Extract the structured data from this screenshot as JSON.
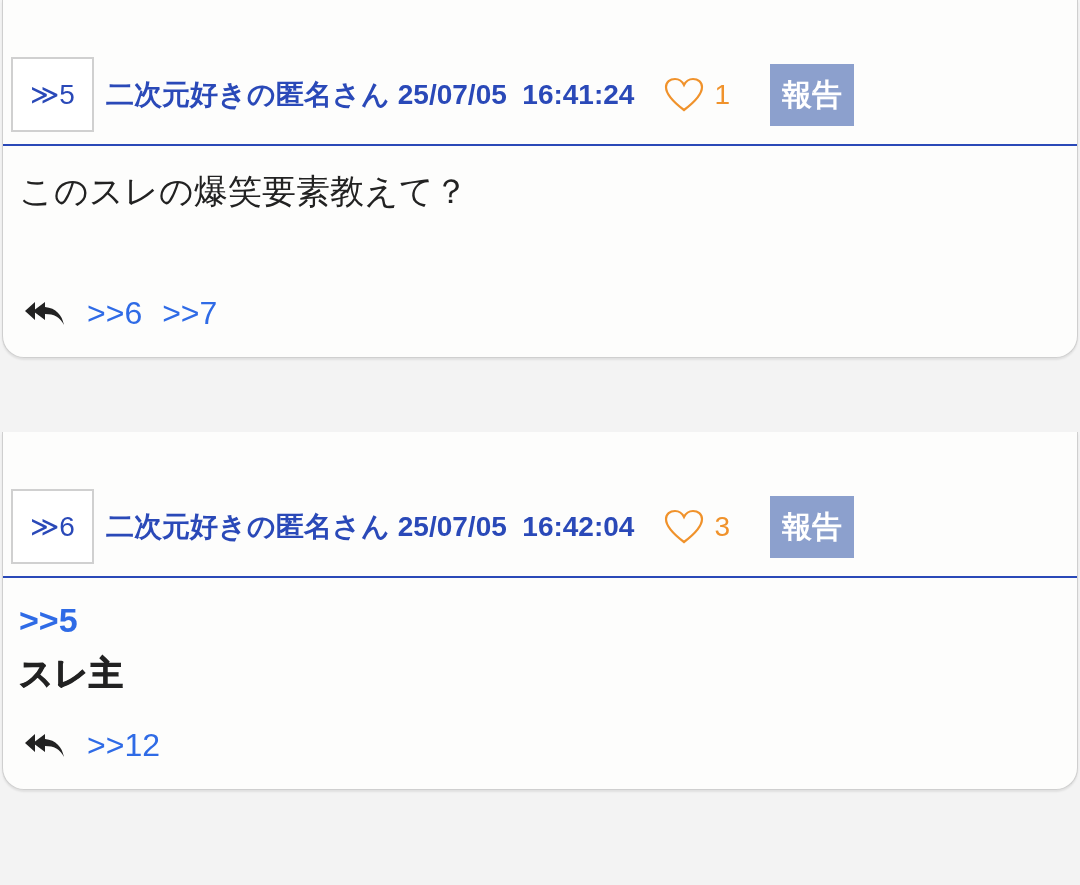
{
  "posts": [
    {
      "number": "≫5",
      "name": "二次元好きの匿名さん",
      "date": "25/07/05",
      "time": "16:41:24",
      "likes": "1",
      "report": "報告",
      "body": [
        {
          "kind": "text",
          "text": "このスレの爆笑要素教えて？",
          "bold": false
        }
      ],
      "replies": [
        ">>6",
        ">>7"
      ]
    },
    {
      "number": "≫6",
      "name": "二次元好きの匿名さん",
      "date": "25/07/05",
      "time": "16:42:04",
      "likes": "3",
      "report": "報告",
      "body": [
        {
          "kind": "anchor",
          "text": ">>5"
        },
        {
          "kind": "text",
          "text": "スレ主",
          "bold": true
        }
      ],
      "replies": [
        ">>12"
      ]
    }
  ]
}
